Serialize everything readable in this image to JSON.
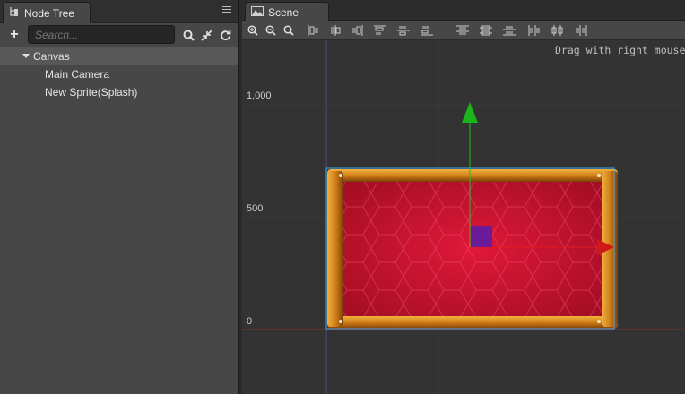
{
  "node_tree": {
    "tab_label": "Node Tree",
    "search_placeholder": "Search...",
    "items": [
      {
        "label": "Canvas",
        "expanded": true,
        "selected": true
      },
      {
        "label": "Main Camera"
      },
      {
        "label": "New Sprite(Splash)"
      }
    ]
  },
  "scene": {
    "tab_label": "Scene",
    "hint": "Drag with right mouse",
    "axis_labels": [
      "1,000",
      "500",
      "0"
    ],
    "icons": {
      "zoom_in": "zoom-in-icon",
      "zoom_out": "zoom-out-icon",
      "zoom_reset": "zoom-reset-icon"
    }
  },
  "colors": {
    "panel_bg": "#474747",
    "scene_bg": "#333333",
    "sprite_red": "#c8102e",
    "frame_wood": "#d98a1c",
    "gizmo_x": "#e01b1b",
    "gizmo_y": "#1ec21e",
    "gizmo_center": "#6a1b9a",
    "selection": "#3fa9f5"
  }
}
